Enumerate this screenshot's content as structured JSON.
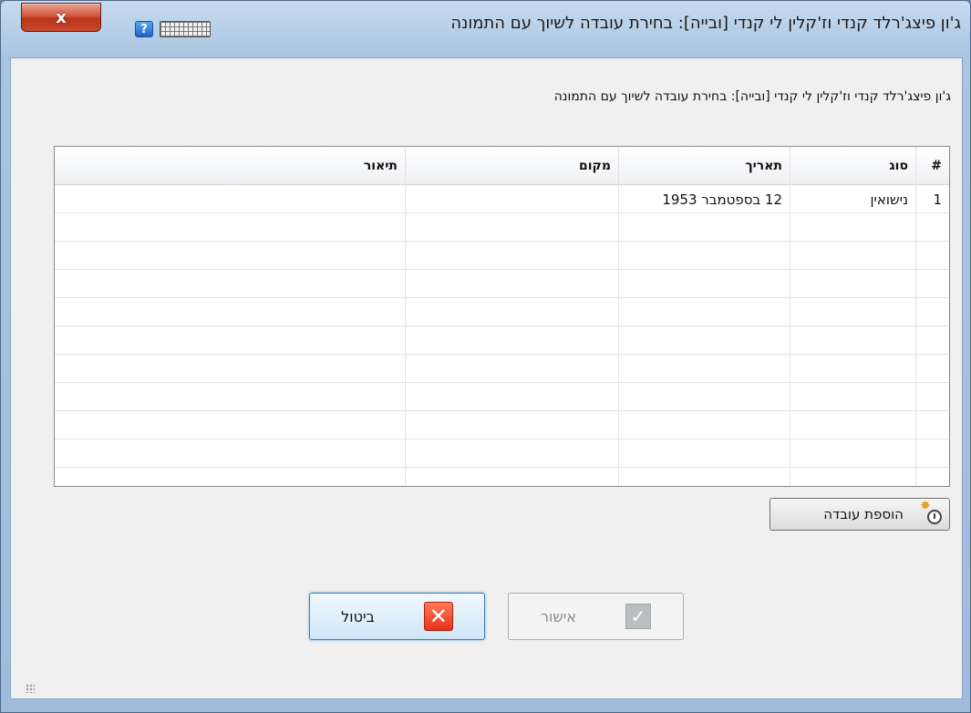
{
  "window": {
    "title": "ג'ון פיצג'רלד קנדי וז'קלין לי קנדי [ובייה]: בחירת עובדה לשיוך עם התמונה",
    "close_label": "x",
    "help_label": "?"
  },
  "dialog": {
    "subtitle": "ג'ון פיצג'רלד קנדי וז'קלין לי קנדי [ובייה]: בחירת עובדה לשיוך עם התמונה"
  },
  "table": {
    "columns": [
      "#",
      "סוג",
      "תאריך",
      "מקום",
      "תיאור"
    ],
    "rows": [
      [
        "1",
        "נישואין",
        "12 בספטמבר 1953",
        "",
        ""
      ]
    ]
  },
  "buttons": {
    "add_fact": "הוספת עובדה",
    "ok": "אישור",
    "cancel": "ביטול"
  },
  "icons": {
    "close": "close-icon",
    "help": "help-icon",
    "keyboard": "keyboard-icon",
    "add_fact": "add-fact-icon",
    "ok": "checkmark-icon",
    "cancel": "cross-icon"
  }
}
